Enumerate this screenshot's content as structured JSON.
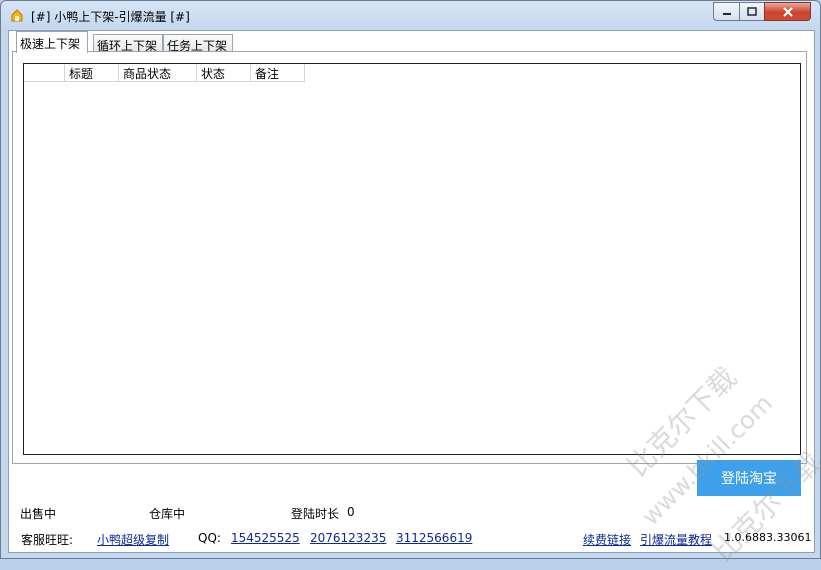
{
  "window": {
    "title": "[#] 小鸭上下架-引爆流量 [#]",
    "controls": {
      "minimize": "—",
      "maximize": "☐",
      "close": "✕"
    }
  },
  "tabs": [
    {
      "label": "极速上下架",
      "active": true
    },
    {
      "label": "循环上下架",
      "active": false
    },
    {
      "label": "任务上下架",
      "active": false
    }
  ],
  "list": {
    "columns": [
      "",
      "标题",
      "商品状态",
      "状态",
      "备注"
    ],
    "rows": []
  },
  "status": {
    "on_sale": "出售中",
    "in_warehouse": "仓库中",
    "login_duration_label": "登陆时长",
    "login_duration_value": "0"
  },
  "login_button": "登陆淘宝",
  "footer": {
    "service_label": "客服旺旺:",
    "service_link": "小鸭超级复制",
    "qq_label": "QQ:",
    "qq_numbers": [
      "154525525",
      "2076123235",
      "3112566619"
    ],
    "renew_link": "续费链接",
    "tutorial_link": "引爆流量教程",
    "version": "1.0.6883.33061"
  },
  "watermark": {
    "text1": "比克尔下载",
    "text2": "www.bkill.com",
    "text3": "比克尔下载"
  },
  "colors": {
    "accent": "#3ea0ea",
    "link": "#0b2a9a",
    "close_button": "#c9432e"
  }
}
